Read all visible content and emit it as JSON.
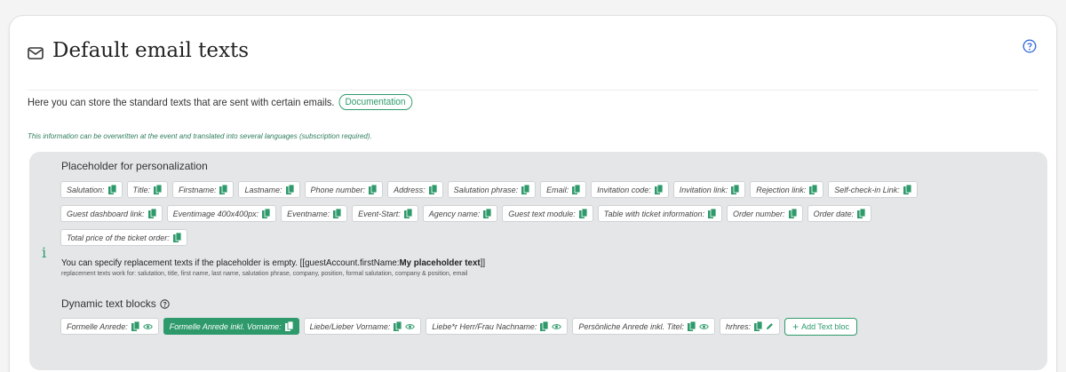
{
  "header": {
    "title": "Default email texts"
  },
  "intro": {
    "text": "Here you can store the standard texts that are sent with certain emails.",
    "doc_link": "Documentation",
    "note": "This information can be overwritten at the event and translated into several languages (subscription required)."
  },
  "placeholders": {
    "title": "Placeholder for personalization",
    "rows": [
      [
        "Salutation:",
        "Title:",
        "Firstname:",
        "Lastname:",
        "Phone number:",
        "Address:",
        "Salutation phrase:",
        "Email:",
        "Invitation code:",
        "Invitation link:",
        "Rejection link:",
        "Self-check-in Link:"
      ],
      [
        "Guest dashboard link:",
        "Eventimage 400x400px:",
        "Eventname:",
        "Event-Start:",
        "Agency name:",
        "Guest text module:",
        "Table with ticket information:",
        "Order number:",
        "Order date:"
      ],
      [
        "Total price of the ticket order:"
      ]
    ],
    "replacement_prefix": "You can specify replacement texts if the placeholder is empty. [[guestAccount.firstName:",
    "replacement_bold": "My placeholder text",
    "replacement_suffix": "]]",
    "replacement_sub": "replacement texts work for: salutation, title, first name, last name, salutation phrase, company, position, formal salutation, company & position, email"
  },
  "dynamic": {
    "title": "Dynamic text blocks",
    "blocks": [
      {
        "label": "Formelle Anrede:",
        "icons": [
          "copy-icon",
          "eye-icon"
        ],
        "active": false
      },
      {
        "label": "Formelle Anrede inkl. Vorname:",
        "icons": [
          "copy-icon"
        ],
        "active": true
      },
      {
        "label": "Liebe/Lieber Vorname:",
        "icons": [
          "copy-icon",
          "eye-icon"
        ],
        "active": false
      },
      {
        "label": "Liebe*r Herr/Frau Nachname:",
        "icons": [
          "copy-icon",
          "eye-icon"
        ],
        "active": false
      },
      {
        "label": "Persönliche Anrede inkl. Titel:",
        "icons": [
          "copy-icon",
          "eye-icon"
        ],
        "active": false
      },
      {
        "label": "hrhres:",
        "icons": [
          "copy-icon",
          "pencil-icon"
        ],
        "active": false
      }
    ],
    "add_label": "Add Text bloc"
  },
  "colors": {
    "accent": "#2e9a6b",
    "panel": "#e5e6e8"
  }
}
